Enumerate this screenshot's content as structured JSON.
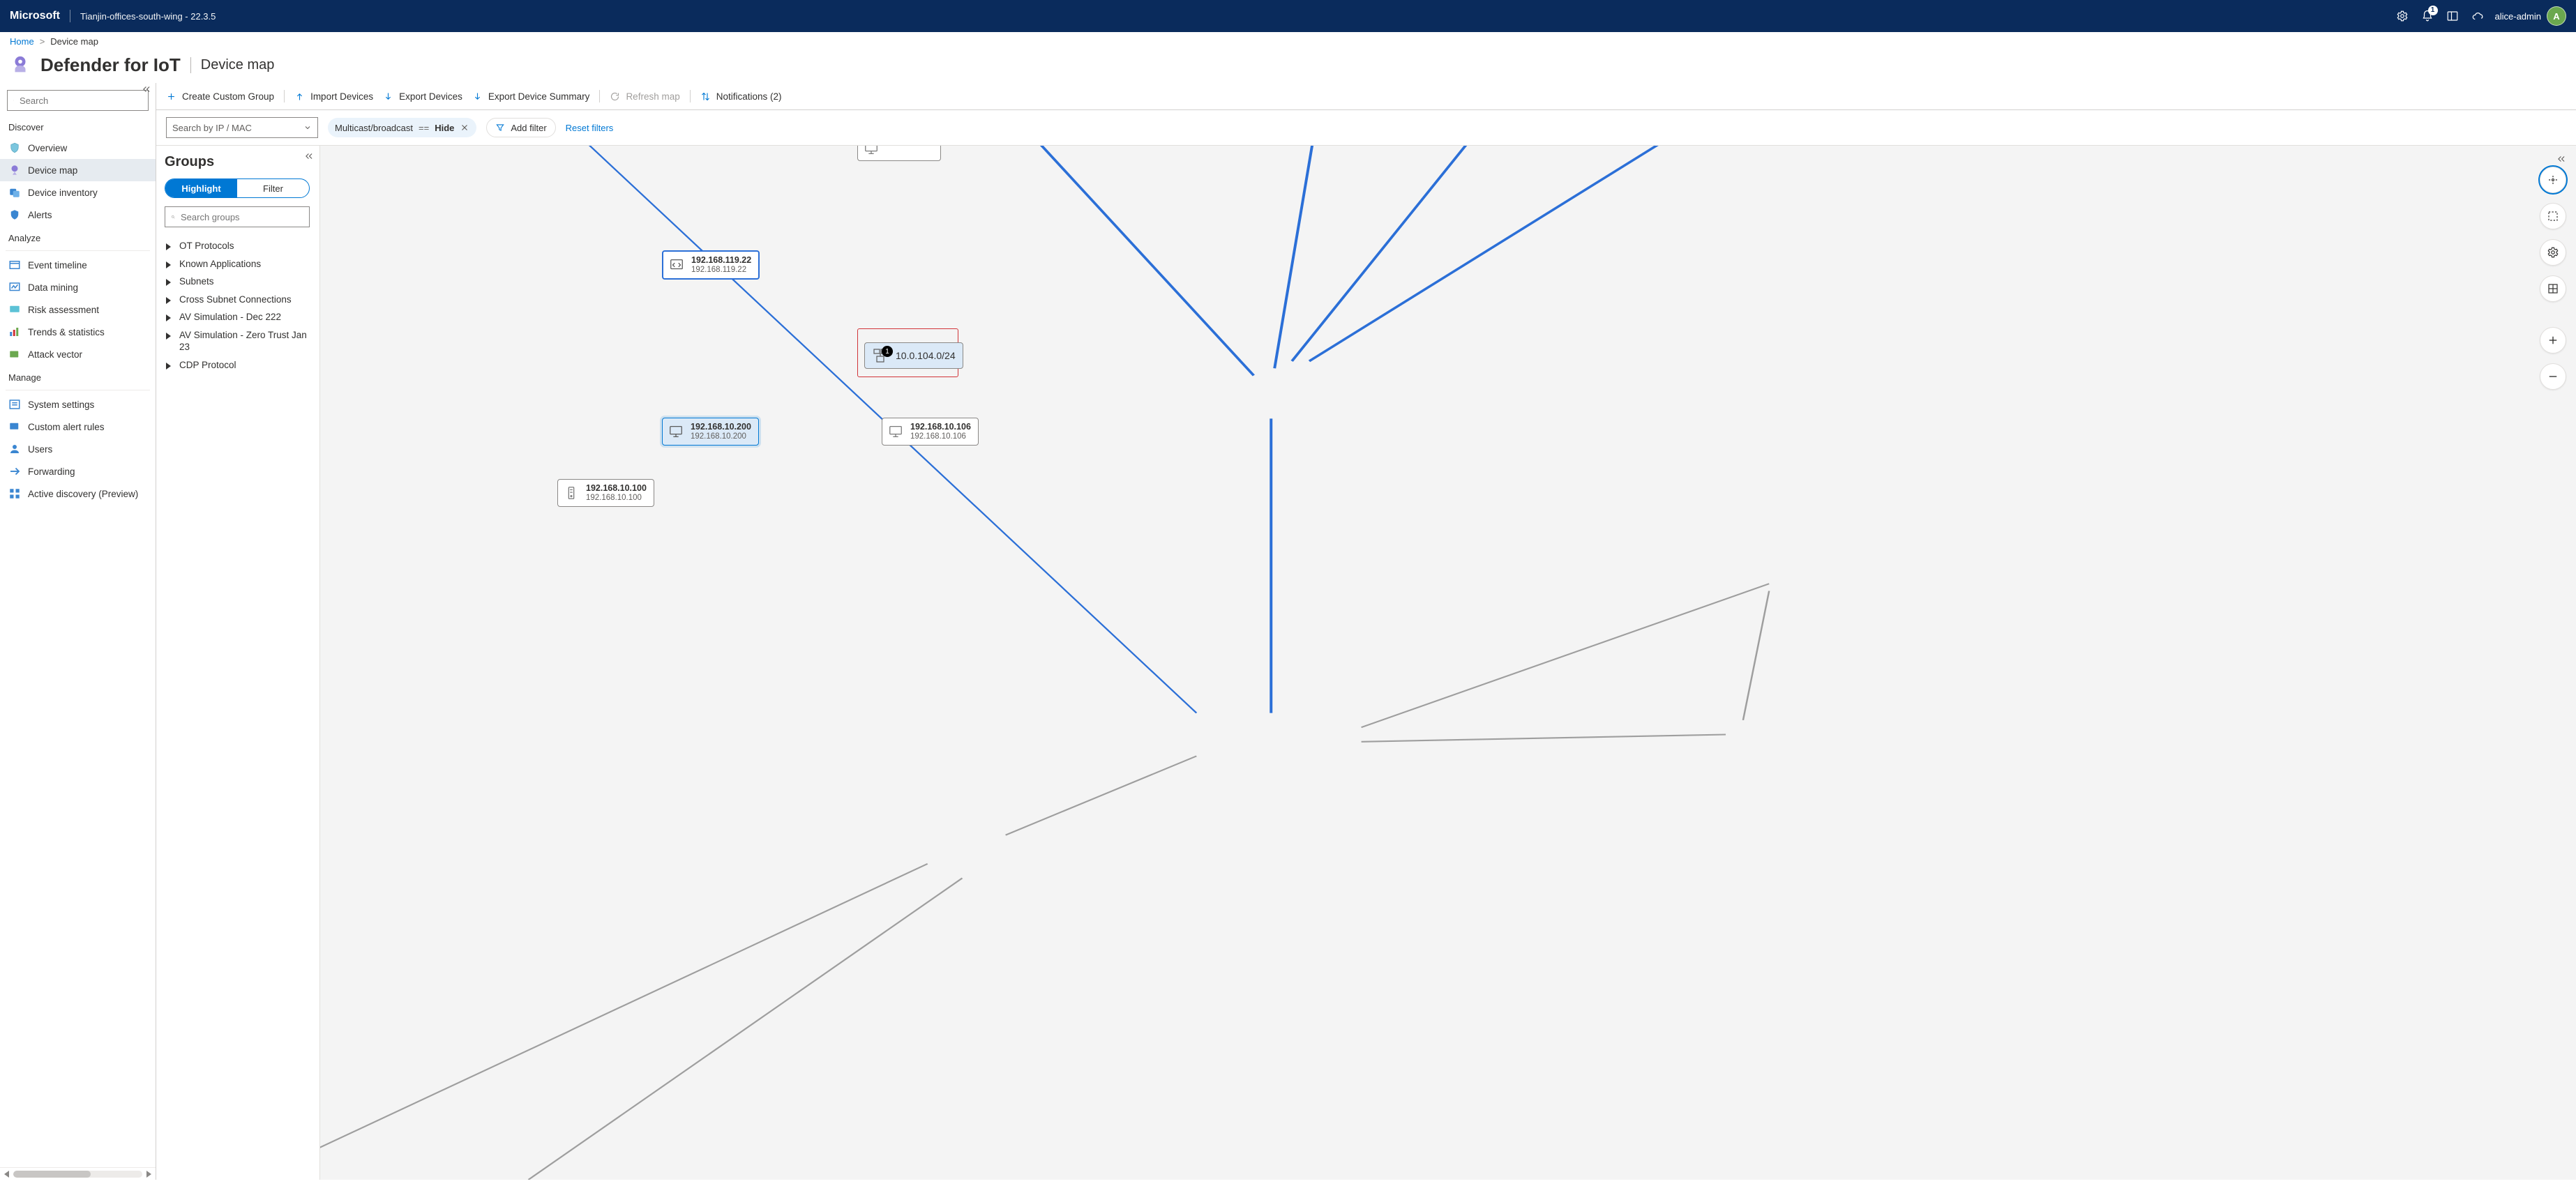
{
  "topbar": {
    "brand": "Microsoft",
    "site": "Tianjin-offices-south-wing - 22.3.5",
    "notification_count": "1",
    "username": "alice-admin",
    "avatar_letter": "A"
  },
  "breadcrumbs": {
    "home": "Home",
    "current": "Device map"
  },
  "page": {
    "product": "Defender for IoT",
    "subtitle": "Device map"
  },
  "search": {
    "placeholder": "Search"
  },
  "leftnav": {
    "sections": {
      "discover": "Discover",
      "analyze": "Analyze",
      "manage": "Manage"
    },
    "overview": "Overview",
    "device_map": "Device map",
    "device_inventory": "Device inventory",
    "alerts": "Alerts",
    "event_timeline": "Event timeline",
    "data_mining": "Data mining",
    "risk_assessment": "Risk assessment",
    "trends": "Trends & statistics",
    "attack_vector": "Attack vector",
    "system_settings": "System settings",
    "custom_alert_rules": "Custom alert rules",
    "users": "Users",
    "forwarding": "Forwarding",
    "active_discovery": "Active discovery (Preview)"
  },
  "toolbar": {
    "create_group": "Create Custom Group",
    "import": "Import Devices",
    "export": "Export Devices",
    "export_summary": "Export Device Summary",
    "refresh": "Refresh map",
    "notifications": "Notifications (2)"
  },
  "filterbar": {
    "ip_placeholder": "Search by IP / MAC",
    "chip_field": "Multicast/broadcast",
    "chip_op": "==",
    "chip_value": "Hide",
    "add_filter": "Add filter",
    "reset": "Reset filters"
  },
  "groups": {
    "title": "Groups",
    "highlight": "Highlight",
    "filter": "Filter",
    "search_placeholder": "Search groups",
    "items": [
      "OT Protocols",
      "Known Applications",
      "Subnets",
      "Cross Subnet Connections",
      "AV Simulation - Dec 222",
      "AV Simulation - Zero Trust Jan 23",
      "CDP Protocol"
    ]
  },
  "map": {
    "subnet": {
      "label": "10.0.104.0/24",
      "badge": "1"
    },
    "devices": [
      {
        "id": "d119",
        "ip": "192.168.119.22",
        "sub": "192.168.119.22"
      },
      {
        "id": "d200",
        "ip": "192.168.10.200",
        "sub": "192.168.10.200"
      },
      {
        "id": "d106",
        "ip": "192.168.10.106",
        "sub": "192.168.10.106"
      },
      {
        "id": "d100",
        "ip": "192.168.10.100",
        "sub": "192.168.10.100"
      }
    ]
  }
}
